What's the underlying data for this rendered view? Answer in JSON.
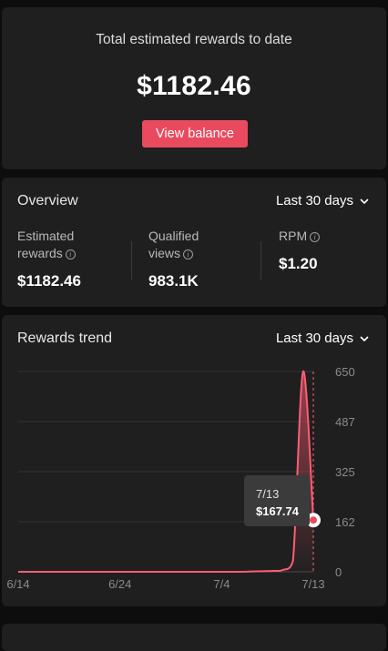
{
  "total": {
    "label": "Total estimated rewards to date",
    "amount": "$1182.46",
    "button_label": "View balance"
  },
  "overview": {
    "title": "Overview",
    "range": "Last 30 days",
    "metrics": [
      {
        "label_line1": "Estimated",
        "label_line2": "rewards",
        "value": "$1182.46",
        "has_info": true
      },
      {
        "label_line1": "Qualified",
        "label_line2": "views",
        "value": "983.1K",
        "has_info": true
      },
      {
        "label_line1": "RPM",
        "label_line2": "",
        "value": "$1.20",
        "has_info": true
      }
    ]
  },
  "trend": {
    "title": "Rewards trend",
    "range": "Last 30 days",
    "tooltip": {
      "date": "7/13",
      "value": "$167.74"
    }
  },
  "colors": {
    "accent": "#ea4a5e",
    "line": "#ff5d73",
    "card_bg": "#1f1f1f",
    "page_bg": "#0d0d0d"
  },
  "chart_data": {
    "type": "area",
    "title": "",
    "xlabel": "",
    "ylabel": "",
    "x_ticks": [
      "6/14",
      "6/24",
      "7/4",
      "7/13"
    ],
    "y_ticks": [
      0,
      162,
      325,
      487,
      650
    ],
    "ylim": [
      0,
      650
    ],
    "y_axis_side": "right",
    "grid": true,
    "series": [
      {
        "x": [
          "6/14",
          "6/15",
          "6/16",
          "6/17",
          "6/18",
          "6/19",
          "6/20",
          "6/21",
          "6/22",
          "6/23",
          "6/24",
          "6/25",
          "6/26",
          "6/27",
          "6/28",
          "6/29",
          "6/30",
          "7/1",
          "7/2",
          "7/3",
          "7/4",
          "7/5",
          "7/6",
          "7/7",
          "7/8",
          "7/9",
          "7/10",
          "7/11",
          "7/12",
          "7/13"
        ],
        "values": [
          0,
          0,
          0,
          0,
          0,
          0,
          0,
          0,
          0,
          0,
          0,
          0,
          0,
          0,
          0,
          0,
          0,
          0,
          0,
          0,
          0,
          0,
          0,
          1,
          2,
          3,
          6,
          35,
          650,
          167.74
        ]
      }
    ],
    "highlight": {
      "x": "7/13",
      "value": 167.74
    }
  }
}
